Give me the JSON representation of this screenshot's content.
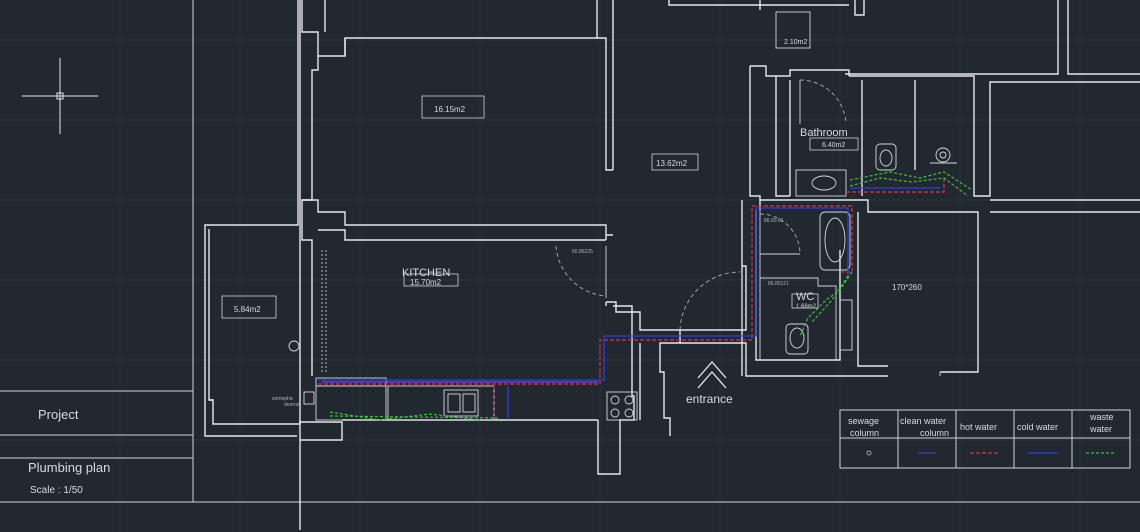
{
  "title_block": {
    "project": "Project",
    "sheet_title": "Plumbing plan",
    "scale": "Scale : 1/50"
  },
  "rooms": {
    "top_room_area": "2.10m2",
    "room_1_area": "16.15m2",
    "room_2_area": "13.62m2",
    "bathroom_name": "Bathroom",
    "bathroom_area": "6.40m2",
    "kitchen_name": "KITCHEN",
    "kitchen_area": "15.70m2",
    "balcony_area": "5.84m2",
    "wc_name": "WC",
    "wc_area": "1.68m2",
    "dimension_note": "170*260",
    "entrance_label": "entrance"
  },
  "legend": {
    "headers": [
      "sewage column",
      "clean water column",
      "hot water",
      "cold water",
      "waste water"
    ],
    "colors": {
      "sewage": "#9aa0a8",
      "clean": "#3b4bd6",
      "hot": "#e0304a",
      "cold": "#2f3fe0",
      "waste": "#3fbf3a"
    }
  },
  "pipe_colors": {
    "hot": "#e0304a",
    "cold": "#2f3fe0",
    "waste": "#3fbf3a",
    "purple": "#8a3fd6"
  }
}
